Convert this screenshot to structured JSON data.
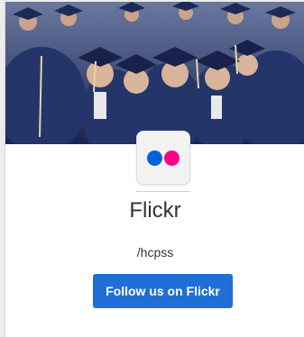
{
  "card": {
    "hero_image": "graduates-in-caps-photo",
    "icon": "flickr-icon",
    "title": "Flickr",
    "handle": "/hcpss",
    "button_label": "Follow us on Flickr"
  },
  "colors": {
    "flickr_blue": "#0063dc",
    "flickr_pink": "#ff0084",
    "button": "#1f6fd6"
  }
}
